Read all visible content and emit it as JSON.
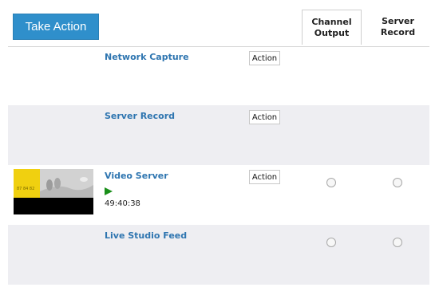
{
  "toolbar": {
    "take_action_label": "Take Action"
  },
  "columns": {
    "channel_output": "Channel\nOutput",
    "server_record": "Server\nRecord"
  },
  "rows": [
    {
      "title": "Network Capture",
      "action_label": "Action"
    },
    {
      "title": "Server Record",
      "action_label": "Action"
    },
    {
      "title": "Video Server",
      "action_label": "Action",
      "status_icon": "play-icon",
      "timecode": "49:40:38",
      "thumbnail_text": "87 84 82"
    },
    {
      "title": "Live Studio Feed"
    }
  ],
  "colors": {
    "accent": "#2f8fcb",
    "link": "#2e75b0",
    "row_alt": "#eeeef2",
    "play": "#1a8f1a"
  }
}
